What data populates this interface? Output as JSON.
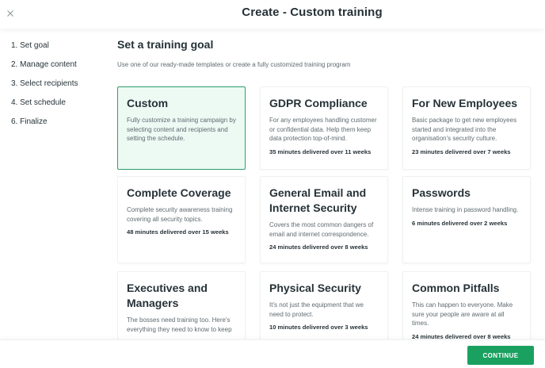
{
  "header": {
    "title": "Create - Custom training",
    "close_icon": "close-icon"
  },
  "steps": [
    {
      "label": "1. Set goal"
    },
    {
      "label": "2. Manage content"
    },
    {
      "label": "3. Select recipients"
    },
    {
      "label": "4. Set schedule"
    },
    {
      "label": "6. Finalize"
    }
  ],
  "main": {
    "title": "Set a training goal",
    "subtitle": "Use one of our ready-made templates or create a fully customized training program"
  },
  "cards": [
    {
      "title": "Custom",
      "desc": "Fully customize a training campaign by selecting content and recipients and setting the schedule.",
      "meta": "",
      "selected": true
    },
    {
      "title": "GDPR Compliance",
      "desc": "For any employees handling customer or confidential data. Help them keep data protection top-of-mind.",
      "meta": "35 minutes delivered over 11 weeks"
    },
    {
      "title": "For New Employees",
      "desc": "Basic package to get new employees started and integrated into the organisation's security culture.",
      "meta": "23 minutes delivered over 7 weeks"
    },
    {
      "title": "Complete Coverage",
      "desc": "Complete security awareness training covering all security topics.",
      "meta": "48 minutes delivered over 15 weeks"
    },
    {
      "title": "General Email and Internet Security",
      "desc": "Covers the most common dangers of email and internet correspondence.",
      "meta": "24 minutes delivered over 8 weeks"
    },
    {
      "title": "Passwords",
      "desc": "Intense training in password handling.",
      "meta": "6 minutes delivered over 2 weeks"
    },
    {
      "title": "Executives and Managers",
      "desc": "The bosses need training too. Here's everything they need to know to keep",
      "meta": ""
    },
    {
      "title": "Physical Security",
      "desc": "It's not just the equipment that we need to protect.",
      "meta": "10 minutes delivered over 3 weeks"
    },
    {
      "title": "Common Pitfalls",
      "desc": "This can happen to everyone. Make sure your people are aware at all times.",
      "meta": "24 minutes delivered over 8 weeks"
    }
  ],
  "footer": {
    "continue_label": "CONTINUE"
  },
  "colors": {
    "accent": "#1aa160",
    "selected_bg": "#edf9f3",
    "selected_border": "#2e9e6c"
  }
}
